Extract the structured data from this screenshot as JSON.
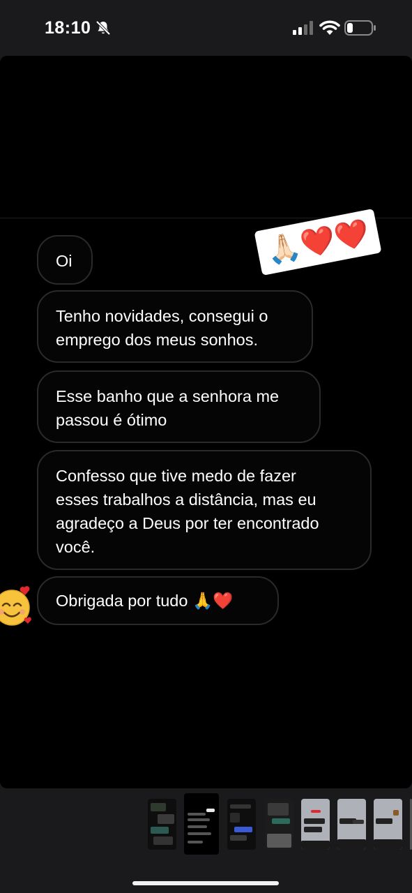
{
  "status_bar": {
    "time": "18:10",
    "silent_mode": true,
    "icons": [
      "bell-slash-icon",
      "cellular-signal-icon",
      "wifi-icon",
      "battery-icon"
    ],
    "battery_level": 0.2
  },
  "chat": {
    "messages": [
      {
        "id": "msg-oi",
        "lines": [
          "Oi"
        ]
      },
      {
        "id": "msg-novidades",
        "lines": [
          "Tenho novidades, consegui o",
          "emprego dos meus sonhos."
        ]
      },
      {
        "id": "msg-banho",
        "lines": [
          "Esse banho que a senhora me",
          "passou é ótimo"
        ]
      },
      {
        "id": "msg-confesso",
        "lines": [
          "Confesso que tive medo de fazer",
          "esses trabalhos a distância, mas eu",
          "agradeço a Deus por ter encontrado",
          "você."
        ]
      },
      {
        "id": "msg-obrigada",
        "lines": [
          "Obrigada por tudo 🙏❤️"
        ]
      }
    ],
    "sticker": "🙏🏻❤️❤️",
    "side_emoji": "smiling-face-with-hearts-icon"
  },
  "thumbnails": {
    "count": 8,
    "active_index": 1
  },
  "colors": {
    "background": "#1a1a1c",
    "story_background": "#000000",
    "bubble_border": "#2a2a2a",
    "heart_red": "#e0282e"
  }
}
